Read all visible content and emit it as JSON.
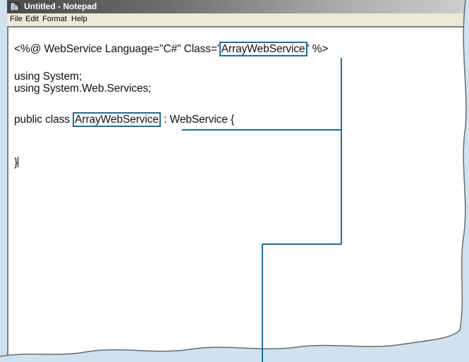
{
  "window": {
    "title": "Untitled - Notepad",
    "icon": "notepad-icon"
  },
  "menu": [
    "File",
    "Edit",
    "Format",
    "Help"
  ],
  "code": {
    "line1_pre": "<%@ WebService Language=\"C#\" Class='",
    "line1_class": "ArrayWebService",
    "line1_post": "' %>",
    "line2": "using System;",
    "line3": "using System.Web.Services;",
    "line4_pre": "public class ",
    "line4_class": "ArrayWebService",
    "line4_post": " : WebService {",
    "line5": "}"
  },
  "colors": {
    "highlight": "#1a6fa0",
    "background": "#cfe2ee"
  }
}
